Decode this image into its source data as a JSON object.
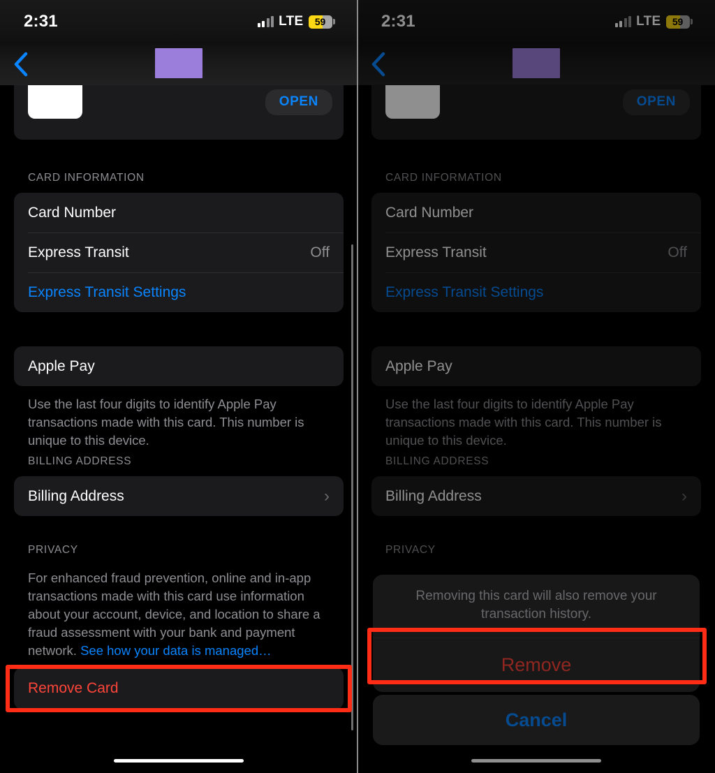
{
  "statusbar": {
    "time": "2:31",
    "network_label": "LTE",
    "battery_percent": "59",
    "battery_fill_color": "#fcd713",
    "signal_icon": "cellular-bars-icon",
    "battery_icon": "battery-icon"
  },
  "navbar": {
    "back_icon": "chevron-left-icon",
    "title_redacted": true,
    "title_block_color": "#9b7edc"
  },
  "card_row": {
    "app_icon": "bank-app-icon",
    "open_label": "OPEN"
  },
  "sections": {
    "card_information": {
      "header": "CARD INFORMATION",
      "rows": [
        {
          "label": "Card Number",
          "value": ""
        },
        {
          "label": "Express Transit",
          "value": "Off"
        },
        {
          "label": "Express Transit Settings",
          "value": "",
          "style": "link"
        }
      ]
    },
    "apple_pay": {
      "row_label": "Apple Pay",
      "description": "Use the last four digits to identify Apple Pay transactions made with this card. This number is unique to this device."
    },
    "billing_address": {
      "header": "BILLING ADDRESS",
      "row_label": "Billing Address",
      "chevron_icon": "chevron-right-icon",
      "chevron_glyph": "›"
    },
    "privacy": {
      "header": "PRIVACY",
      "description": "For enhanced fraud prevention, online and in-app transactions made with this card use information about your account, device, and location to share a fraud assessment with your bank and payment network. ",
      "link_text": "See how your data is managed…"
    },
    "remove_card": {
      "label": "Remove Card",
      "color": "#ff453a"
    }
  },
  "action_sheet": {
    "message": "Removing this card will also remove your transaction history.",
    "remove_label": "Remove",
    "cancel_label": "Cancel",
    "remove_color": "#ff453a",
    "cancel_color": "#0a84ff"
  },
  "annotations": {
    "highlight_color": "#ff2d16",
    "left_target": "Remove Card",
    "right_target": "Remove"
  },
  "chrome": {
    "home_indicator": "home-indicator",
    "scrollbar": "vertical-scrollbar",
    "divider": "panel-divider"
  }
}
